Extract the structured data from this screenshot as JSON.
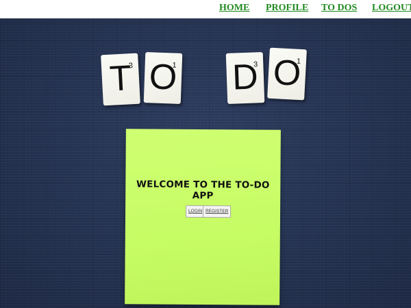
{
  "nav": {
    "items": [
      {
        "label": "HOME"
      },
      {
        "label": "PROFILE"
      },
      {
        "label": "TO DOS"
      },
      {
        "label": "LOGOUT"
      }
    ],
    "link_color": "#1f8a1f"
  },
  "hero_tiles": [
    {
      "letter": "T",
      "score": "3"
    },
    {
      "letter": "O",
      "score": "1"
    },
    {
      "letter": "D",
      "score": "3"
    },
    {
      "letter": "O",
      "score": "1"
    }
  ],
  "note": {
    "title": "WELCOME TO THE TO-DO APP",
    "login_label": "LOGIN",
    "register_label": "REGISTER",
    "color": "#c8fc66"
  },
  "background_color": "#263455"
}
